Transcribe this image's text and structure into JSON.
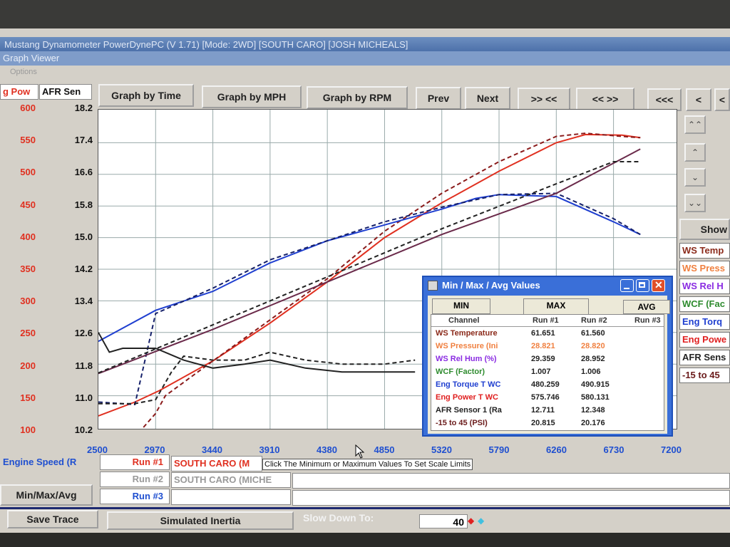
{
  "window": {
    "title": "Mustang Dynamometer PowerDynePC (V 1.71) [Mode: 2WD] [SOUTH CARO] [JOSH MICHEALS]",
    "subtitle": "Graph Viewer",
    "menu": "Options"
  },
  "axis_selectors": {
    "left_a": "g Pow",
    "left_b": "AFR Sen"
  },
  "toolbar": {
    "graph_by_time": "Graph by Time",
    "graph_by_mph": "Graph by MPH",
    "graph_by_rpm": "Graph by RPM",
    "prev": "Prev",
    "next": "Next",
    "zoom_in": ">> <<",
    "zoom_out": "<< >>",
    "first": "<<<",
    "left": "<",
    "right": "<"
  },
  "side_controls": {
    "show": "Show",
    "channels": [
      {
        "label": "WS Temp",
        "color": "#8b2a1a"
      },
      {
        "label": "WS Press",
        "color": "#f08040"
      },
      {
        "label": "WS Rel H",
        "color": "#8a2be2"
      },
      {
        "label": "WCF (Fac",
        "color": "#2e8b2e"
      },
      {
        "label": "Eng Torq",
        "color": "#1f3fd0"
      },
      {
        "label": "Eng Powe",
        "color": "#e02020"
      },
      {
        "label": "AFR Sens",
        "color": "#222222"
      },
      {
        "label": "-15 to 45",
        "color": "#6a1a1a"
      }
    ]
  },
  "bottom": {
    "x_channel": "Engine Speed (R",
    "run1_label": "Run #1",
    "run1_name": "SOUTH CARO (M",
    "run2_label": "Run #2",
    "run2_name": "SOUTH CARO (MICHE",
    "run3_label": "Run #3",
    "minmax_button": "Min/Max/Avg",
    "tooltip": "Click The Minimum or Maximum Values To Set Scale Limits",
    "save_trace": "Save Trace",
    "simulated_inertia": "Simulated Inertia",
    "slow_down_label": "Slow Down To:",
    "slow_down_value": "40"
  },
  "dialog": {
    "title": "Min / Max / Avg Values",
    "tab_min": "MIN",
    "tab_max": "MAX",
    "tab_avg": "AVG",
    "col_channel": "Channel",
    "col_run1": "Run #1",
    "col_run2": "Run #2",
    "col_run3": "Run #3",
    "rows": [
      {
        "channel": "WS Temperature",
        "run1": "61.651",
        "run2": "61.560",
        "color": "#8b2a1a"
      },
      {
        "channel": "WS Pressure (Ini",
        "run1": "28.821",
        "run2": "28.820",
        "color": "#f08040"
      },
      {
        "channel": "WS Rel Hum (%)",
        "run1": "29.359",
        "run2": "28.952",
        "color": "#8a2be2"
      },
      {
        "channel": "WCF (Factor)",
        "run1": "1.007",
        "run2": "1.006",
        "color": "#2e8b2e"
      },
      {
        "channel": "Eng Torque T WC",
        "run1": "480.259",
        "run2": "490.915",
        "color": "#1f3fd0"
      },
      {
        "channel": "Eng Power T WC",
        "run1": "575.746",
        "run2": "580.131",
        "color": "#e02020"
      },
      {
        "channel": "AFR Sensor 1 (Ra",
        "run1": "12.711",
        "run2": "12.348",
        "color": "#222222"
      },
      {
        "channel": "-15 to 45 (PSI)",
        "run1": "20.815",
        "run2": "20.176",
        "color": "#6a1a1a"
      }
    ]
  },
  "chart_data": {
    "type": "line",
    "x_ticks": [
      "2500",
      "2970",
      "3440",
      "3910",
      "4380",
      "4850",
      "5320",
      "5790",
      "6260",
      "6730",
      "7200"
    ],
    "y_left_ticks": [
      "600",
      "550",
      "500",
      "450",
      "400",
      "350",
      "300",
      "250",
      "200",
      "150",
      "100"
    ],
    "y_right_ticks": [
      "18.2",
      "17.4",
      "16.6",
      "15.8",
      "15.0",
      "14.2",
      "13.4",
      "12.6",
      "11.8",
      "11.0",
      "10.2"
    ],
    "xlim": [
      2500,
      7200
    ],
    "ylim_power": [
      100,
      600
    ],
    "ylim_afr": [
      10.2,
      18.2
    ],
    "series": [
      {
        "color": "#e03020",
        "dash": false,
        "axis": "power",
        "x": [
          2500,
          2800,
          3000,
          3440,
          3910,
          4380,
          4850,
          5320,
          5790,
          6260,
          6500,
          6800,
          6950
        ],
        "y": [
          118,
          140,
          158,
          205,
          265,
          330,
          400,
          455,
          505,
          550,
          563,
          562,
          558
        ]
      },
      {
        "color": "#8a1a1a",
        "dash": true,
        "axis": "power",
        "x": [
          2870,
          2970,
          3050,
          3440,
          3910,
          4380,
          4850,
          5320,
          5790,
          6260,
          6500,
          6800,
          6950
        ],
        "y": [
          100,
          122,
          150,
          205,
          270,
          335,
          410,
          470,
          520,
          560,
          565,
          560,
          558
        ]
      },
      {
        "color": "#1f3fd0",
        "dash": false,
        "axis": "power",
        "x": [
          2500,
          2970,
          3440,
          3910,
          4380,
          4850,
          5320,
          5600,
          5790,
          6260,
          6730,
          6950
        ],
        "y": [
          236,
          285,
          315,
          360,
          395,
          420,
          445,
          462,
          468,
          465,
          425,
          405
        ]
      },
      {
        "color": "#15206a",
        "dash": true,
        "axis": "power",
        "x": [
          2500,
          2800,
          2970,
          3440,
          3910,
          4380,
          4850,
          5320,
          5790,
          6260,
          6730,
          6950
        ],
        "y": [
          140,
          136,
          280,
          320,
          365,
          395,
          425,
          448,
          468,
          470,
          430,
          405
        ]
      },
      {
        "color": "#6a2a4a",
        "dash": false,
        "axis": "power",
        "x": [
          2500,
          3440,
          4380,
          5320,
          6260,
          6950
        ],
        "y": [
          185,
          255,
          330,
          405,
          470,
          540
        ]
      },
      {
        "color": "#222222",
        "dash": true,
        "axis": "power",
        "x": [
          2500,
          3440,
          4380,
          5320,
          6260,
          6730,
          6950
        ],
        "y": [
          186,
          262,
          338,
          414,
          485,
          520,
          520
        ]
      }
    ],
    "afr_series": [
      {
        "color": "#222222",
        "dash": false,
        "x": [
          2500,
          2590,
          2700,
          2970,
          3200,
          3440,
          3700,
          3910,
          4200,
          4500,
          4850,
          5100
        ],
        "y": [
          12.6,
          12.1,
          12.2,
          12.2,
          11.9,
          11.7,
          11.8,
          11.9,
          11.7,
          11.6,
          11.6,
          11.6
        ]
      },
      {
        "color": "#222222",
        "dash": true,
        "x": [
          2500,
          2800,
          2970,
          3100,
          3200,
          3440,
          3700,
          3910,
          4200,
          4500,
          4850,
          5100
        ],
        "y": [
          10.8,
          10.8,
          10.9,
          11.6,
          12.0,
          11.9,
          11.9,
          12.1,
          11.9,
          11.8,
          11.8,
          11.9
        ]
      }
    ]
  }
}
